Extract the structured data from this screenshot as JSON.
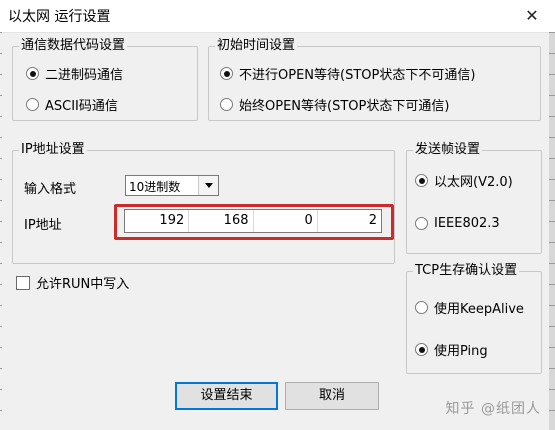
{
  "window": {
    "title": "以太网 运行设置",
    "close_glyph": "✕"
  },
  "comm_code": {
    "legend": "通信数据代码设置",
    "options": [
      {
        "label": "二进制码通信",
        "checked": true
      },
      {
        "label": "ASCII码通信",
        "checked": false
      }
    ]
  },
  "init_time": {
    "legend": "初始时间设置",
    "options": [
      {
        "label": "不进行OPEN等待(STOP状态下不可通信)",
        "checked": true
      },
      {
        "label": "始终OPEN等待(STOP状态下可通信)",
        "checked": false
      }
    ]
  },
  "ip": {
    "legend": "IP地址设置",
    "format_label": "输入格式",
    "format_value": "10进制数",
    "address_label": "IP地址",
    "octets": [
      "192",
      "168",
      "0",
      "2"
    ],
    "highlight_color": "#cc2b2b"
  },
  "send_frame": {
    "legend": "发送帧设置",
    "options": [
      {
        "label": "以太网(V2.0)",
        "checked": true
      },
      {
        "label": "IEEE802.3",
        "checked": false
      }
    ]
  },
  "tcp": {
    "legend": "TCP生存确认设置",
    "options": [
      {
        "label": "使用KeepAlive",
        "checked": false
      },
      {
        "label": "使用Ping",
        "checked": true
      }
    ]
  },
  "run_write": {
    "label": "允许RUN中写入",
    "checked": false
  },
  "buttons": {
    "ok": "设置结束",
    "cancel": "取消"
  },
  "watermark": "知乎 @纸团人"
}
